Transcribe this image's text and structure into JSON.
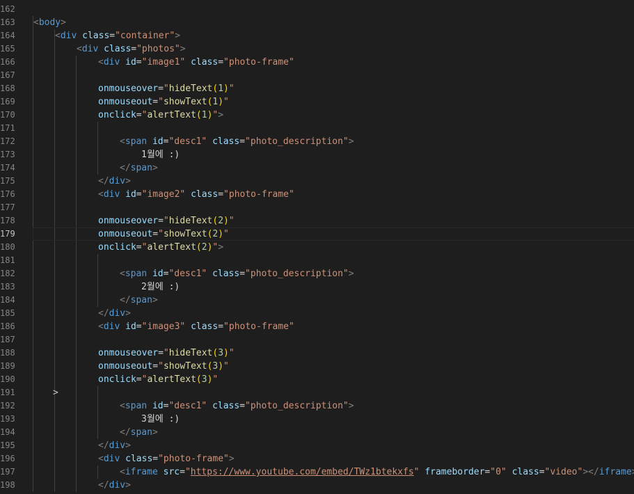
{
  "editor": {
    "active_line": 179,
    "fold_marker": ">",
    "lines": [
      {
        "n": 162,
        "indent": 0,
        "tokens": []
      },
      {
        "n": 163,
        "indent": 0,
        "tokens": [
          [
            "tg",
            "<"
          ],
          [
            "tn",
            "body"
          ],
          [
            "tg",
            ">"
          ]
        ]
      },
      {
        "n": 164,
        "indent": 1,
        "tokens": [
          [
            "tg",
            "<"
          ],
          [
            "tn",
            "div"
          ],
          [
            "tx",
            " "
          ],
          [
            "at",
            "class"
          ],
          [
            "tx",
            "="
          ],
          [
            "st",
            "\"container\""
          ],
          [
            "tg",
            ">"
          ]
        ]
      },
      {
        "n": 165,
        "indent": 2,
        "tokens": [
          [
            "tg",
            "<"
          ],
          [
            "tn",
            "div"
          ],
          [
            "tx",
            " "
          ],
          [
            "at",
            "class"
          ],
          [
            "tx",
            "="
          ],
          [
            "st",
            "\"photos\""
          ],
          [
            "tg",
            ">"
          ]
        ]
      },
      {
        "n": 166,
        "indent": 3,
        "tokens": [
          [
            "tg",
            "<"
          ],
          [
            "tn",
            "div"
          ],
          [
            "tx",
            " "
          ],
          [
            "at",
            "id"
          ],
          [
            "tx",
            "="
          ],
          [
            "st",
            "\"image1\""
          ],
          [
            "tx",
            " "
          ],
          [
            "at",
            "class"
          ],
          [
            "tx",
            "="
          ],
          [
            "st",
            "\"photo-frame\""
          ]
        ]
      },
      {
        "n": 167,
        "indent": 0,
        "tokens": []
      },
      {
        "n": 168,
        "indent": 3,
        "tokens": [
          [
            "at",
            "onmouseover"
          ],
          [
            "tx",
            "="
          ],
          [
            "st",
            "\""
          ],
          [
            "fn",
            "hideText"
          ],
          [
            "pn",
            "("
          ],
          [
            "nm",
            "1"
          ],
          [
            "pn",
            ")"
          ],
          [
            "st",
            "\""
          ]
        ]
      },
      {
        "n": 169,
        "indent": 3,
        "tokens": [
          [
            "at",
            "onmouseout"
          ],
          [
            "tx",
            "="
          ],
          [
            "st",
            "\""
          ],
          [
            "fn",
            "showText"
          ],
          [
            "pn",
            "("
          ],
          [
            "nm",
            "1"
          ],
          [
            "pn",
            ")"
          ],
          [
            "st",
            "\""
          ]
        ]
      },
      {
        "n": 170,
        "indent": 3,
        "tokens": [
          [
            "at",
            "onclick"
          ],
          [
            "tx",
            "="
          ],
          [
            "st",
            "\""
          ],
          [
            "fn",
            "alertText"
          ],
          [
            "pn",
            "("
          ],
          [
            "nm",
            "1"
          ],
          [
            "pn",
            ")"
          ],
          [
            "st",
            "\""
          ],
          [
            "tg",
            ">"
          ]
        ]
      },
      {
        "n": 171,
        "indent": 0,
        "tokens": []
      },
      {
        "n": 172,
        "indent": 4,
        "tokens": [
          [
            "tg",
            "<"
          ],
          [
            "tn",
            "span"
          ],
          [
            "tx",
            " "
          ],
          [
            "at",
            "id"
          ],
          [
            "tx",
            "="
          ],
          [
            "st",
            "\"desc1\""
          ],
          [
            "tx",
            " "
          ],
          [
            "at",
            "class"
          ],
          [
            "tx",
            "="
          ],
          [
            "st",
            "\"photo_description\""
          ],
          [
            "tg",
            ">"
          ]
        ]
      },
      {
        "n": 173,
        "indent": 5,
        "tokens": [
          [
            "tx",
            "1월에 :)"
          ]
        ]
      },
      {
        "n": 174,
        "indent": 4,
        "tokens": [
          [
            "tg",
            "</"
          ],
          [
            "tn",
            "span"
          ],
          [
            "tg",
            ">"
          ]
        ]
      },
      {
        "n": 175,
        "indent": 3,
        "tokens": [
          [
            "tg",
            "</"
          ],
          [
            "tn",
            "div"
          ],
          [
            "tg",
            ">"
          ]
        ]
      },
      {
        "n": 176,
        "indent": 3,
        "tokens": [
          [
            "tg",
            "<"
          ],
          [
            "tn",
            "div"
          ],
          [
            "tx",
            " "
          ],
          [
            "at",
            "id"
          ],
          [
            "tx",
            "="
          ],
          [
            "st",
            "\"image2\""
          ],
          [
            "tx",
            " "
          ],
          [
            "at",
            "class"
          ],
          [
            "tx",
            "="
          ],
          [
            "st",
            "\"photo-frame\""
          ]
        ]
      },
      {
        "n": 177,
        "indent": 0,
        "tokens": []
      },
      {
        "n": 178,
        "indent": 3,
        "tokens": [
          [
            "at",
            "onmouseover"
          ],
          [
            "tx",
            "="
          ],
          [
            "st",
            "\""
          ],
          [
            "fn",
            "hideText"
          ],
          [
            "pn",
            "("
          ],
          [
            "nm",
            "2"
          ],
          [
            "pn",
            ")"
          ],
          [
            "st",
            "\""
          ]
        ]
      },
      {
        "n": 179,
        "indent": 3,
        "tokens": [
          [
            "at",
            "onmouseout"
          ],
          [
            "tx",
            "="
          ],
          [
            "st",
            "\""
          ],
          [
            "fn",
            "showText"
          ],
          [
            "pn",
            "("
          ],
          [
            "nm",
            "2"
          ],
          [
            "pn",
            ")"
          ],
          [
            "st",
            "\""
          ]
        ]
      },
      {
        "n": 180,
        "indent": 3,
        "tokens": [
          [
            "at",
            "onclick"
          ],
          [
            "tx",
            "="
          ],
          [
            "st",
            "\""
          ],
          [
            "fn",
            "alertText"
          ],
          [
            "pn",
            "("
          ],
          [
            "nm",
            "2"
          ],
          [
            "pn",
            ")"
          ],
          [
            "st",
            "\""
          ],
          [
            "tg",
            ">"
          ]
        ]
      },
      {
        "n": 181,
        "indent": 0,
        "tokens": []
      },
      {
        "n": 182,
        "indent": 4,
        "tokens": [
          [
            "tg",
            "<"
          ],
          [
            "tn",
            "span"
          ],
          [
            "tx",
            " "
          ],
          [
            "at",
            "id"
          ],
          [
            "tx",
            "="
          ],
          [
            "st",
            "\"desc1\""
          ],
          [
            "tx",
            " "
          ],
          [
            "at",
            "class"
          ],
          [
            "tx",
            "="
          ],
          [
            "st",
            "\"photo_description\""
          ],
          [
            "tg",
            ">"
          ]
        ]
      },
      {
        "n": 183,
        "indent": 5,
        "tokens": [
          [
            "tx",
            "2월에 :)"
          ]
        ]
      },
      {
        "n": 184,
        "indent": 4,
        "tokens": [
          [
            "tg",
            "</"
          ],
          [
            "tn",
            "span"
          ],
          [
            "tg",
            ">"
          ]
        ]
      },
      {
        "n": 185,
        "indent": 3,
        "tokens": [
          [
            "tg",
            "</"
          ],
          [
            "tn",
            "div"
          ],
          [
            "tg",
            ">"
          ]
        ]
      },
      {
        "n": 186,
        "indent": 3,
        "tokens": [
          [
            "tg",
            "<"
          ],
          [
            "tn",
            "div"
          ],
          [
            "tx",
            " "
          ],
          [
            "at",
            "id"
          ],
          [
            "tx",
            "="
          ],
          [
            "st",
            "\"image3\""
          ],
          [
            "tx",
            " "
          ],
          [
            "at",
            "class"
          ],
          [
            "tx",
            "="
          ],
          [
            "st",
            "\"photo-frame\""
          ]
        ]
      },
      {
        "n": 187,
        "indent": 0,
        "tokens": []
      },
      {
        "n": 188,
        "indent": 3,
        "tokens": [
          [
            "at",
            "onmouseover"
          ],
          [
            "tx",
            "="
          ],
          [
            "st",
            "\""
          ],
          [
            "fn",
            "hideText"
          ],
          [
            "pn",
            "("
          ],
          [
            "nm",
            "3"
          ],
          [
            "pn",
            ")"
          ],
          [
            "st",
            "\""
          ]
        ]
      },
      {
        "n": 189,
        "indent": 3,
        "tokens": [
          [
            "at",
            "onmouseout"
          ],
          [
            "tx",
            "="
          ],
          [
            "st",
            "\""
          ],
          [
            "fn",
            "showText"
          ],
          [
            "pn",
            "("
          ],
          [
            "nm",
            "3"
          ],
          [
            "pn",
            ")"
          ],
          [
            "st",
            "\""
          ]
        ]
      },
      {
        "n": 190,
        "indent": 3,
        "tokens": [
          [
            "at",
            "onclick"
          ],
          [
            "tx",
            "="
          ],
          [
            "st",
            "\""
          ],
          [
            "fn",
            "alertText"
          ],
          [
            "pn",
            "("
          ],
          [
            "nm",
            "3"
          ],
          [
            "pn",
            ")"
          ],
          [
            "st",
            "\""
          ]
        ]
      },
      {
        "n": 191,
        "indent": 0,
        "tokens": []
      },
      {
        "n": 192,
        "indent": 4,
        "tokens": [
          [
            "tg",
            "<"
          ],
          [
            "tn",
            "span"
          ],
          [
            "tx",
            " "
          ],
          [
            "at",
            "id"
          ],
          [
            "tx",
            "="
          ],
          [
            "st",
            "\"desc1\""
          ],
          [
            "tx",
            " "
          ],
          [
            "at",
            "class"
          ],
          [
            "tx",
            "="
          ],
          [
            "st",
            "\"photo_description\""
          ],
          [
            "tg",
            ">"
          ]
        ]
      },
      {
        "n": 193,
        "indent": 5,
        "tokens": [
          [
            "tx",
            "3월에 :)"
          ]
        ]
      },
      {
        "n": 194,
        "indent": 4,
        "tokens": [
          [
            "tg",
            "</"
          ],
          [
            "tn",
            "span"
          ],
          [
            "tg",
            ">"
          ]
        ]
      },
      {
        "n": 195,
        "indent": 3,
        "tokens": [
          [
            "tg",
            "</"
          ],
          [
            "tn",
            "div"
          ],
          [
            "tg",
            ">"
          ]
        ]
      },
      {
        "n": 196,
        "indent": 3,
        "tokens": [
          [
            "tg",
            "<"
          ],
          [
            "tn",
            "div"
          ],
          [
            "tx",
            " "
          ],
          [
            "at",
            "class"
          ],
          [
            "tx",
            "="
          ],
          [
            "st",
            "\"photo-frame\""
          ],
          [
            "tg",
            ">"
          ]
        ]
      },
      {
        "n": 197,
        "indent": 4,
        "tokens": [
          [
            "tg",
            "<"
          ],
          [
            "tn",
            "iframe"
          ],
          [
            "tx",
            " "
          ],
          [
            "at",
            "src"
          ],
          [
            "tx",
            "="
          ],
          [
            "st",
            "\""
          ],
          [
            "stu",
            "https://www.youtube.com/embed/TWz1btekxfs"
          ],
          [
            "st",
            "\""
          ],
          [
            "tx",
            " "
          ],
          [
            "at",
            "frameborder"
          ],
          [
            "tx",
            "="
          ],
          [
            "st",
            "\"0\""
          ],
          [
            "tx",
            " "
          ],
          [
            "at",
            "class"
          ],
          [
            "tx",
            "="
          ],
          [
            "st",
            "\"video\""
          ],
          [
            "tg",
            "></"
          ],
          [
            "tn",
            "iframe"
          ],
          [
            "tg",
            ">"
          ]
        ]
      },
      {
        "n": 198,
        "indent": 3,
        "tokens": [
          [
            "tg",
            "</"
          ],
          [
            "tn",
            "div"
          ],
          [
            "tg",
            ">"
          ]
        ]
      }
    ]
  },
  "colors": {
    "background": "#1e1e1e",
    "line_number": "#858585",
    "tag_bracket": "#808080",
    "tag_name": "#569cd6",
    "attribute": "#9cdcfe",
    "string": "#ce9178",
    "function": "#dcdcaa",
    "number": "#b5cea8",
    "paren": "#ffd700"
  }
}
